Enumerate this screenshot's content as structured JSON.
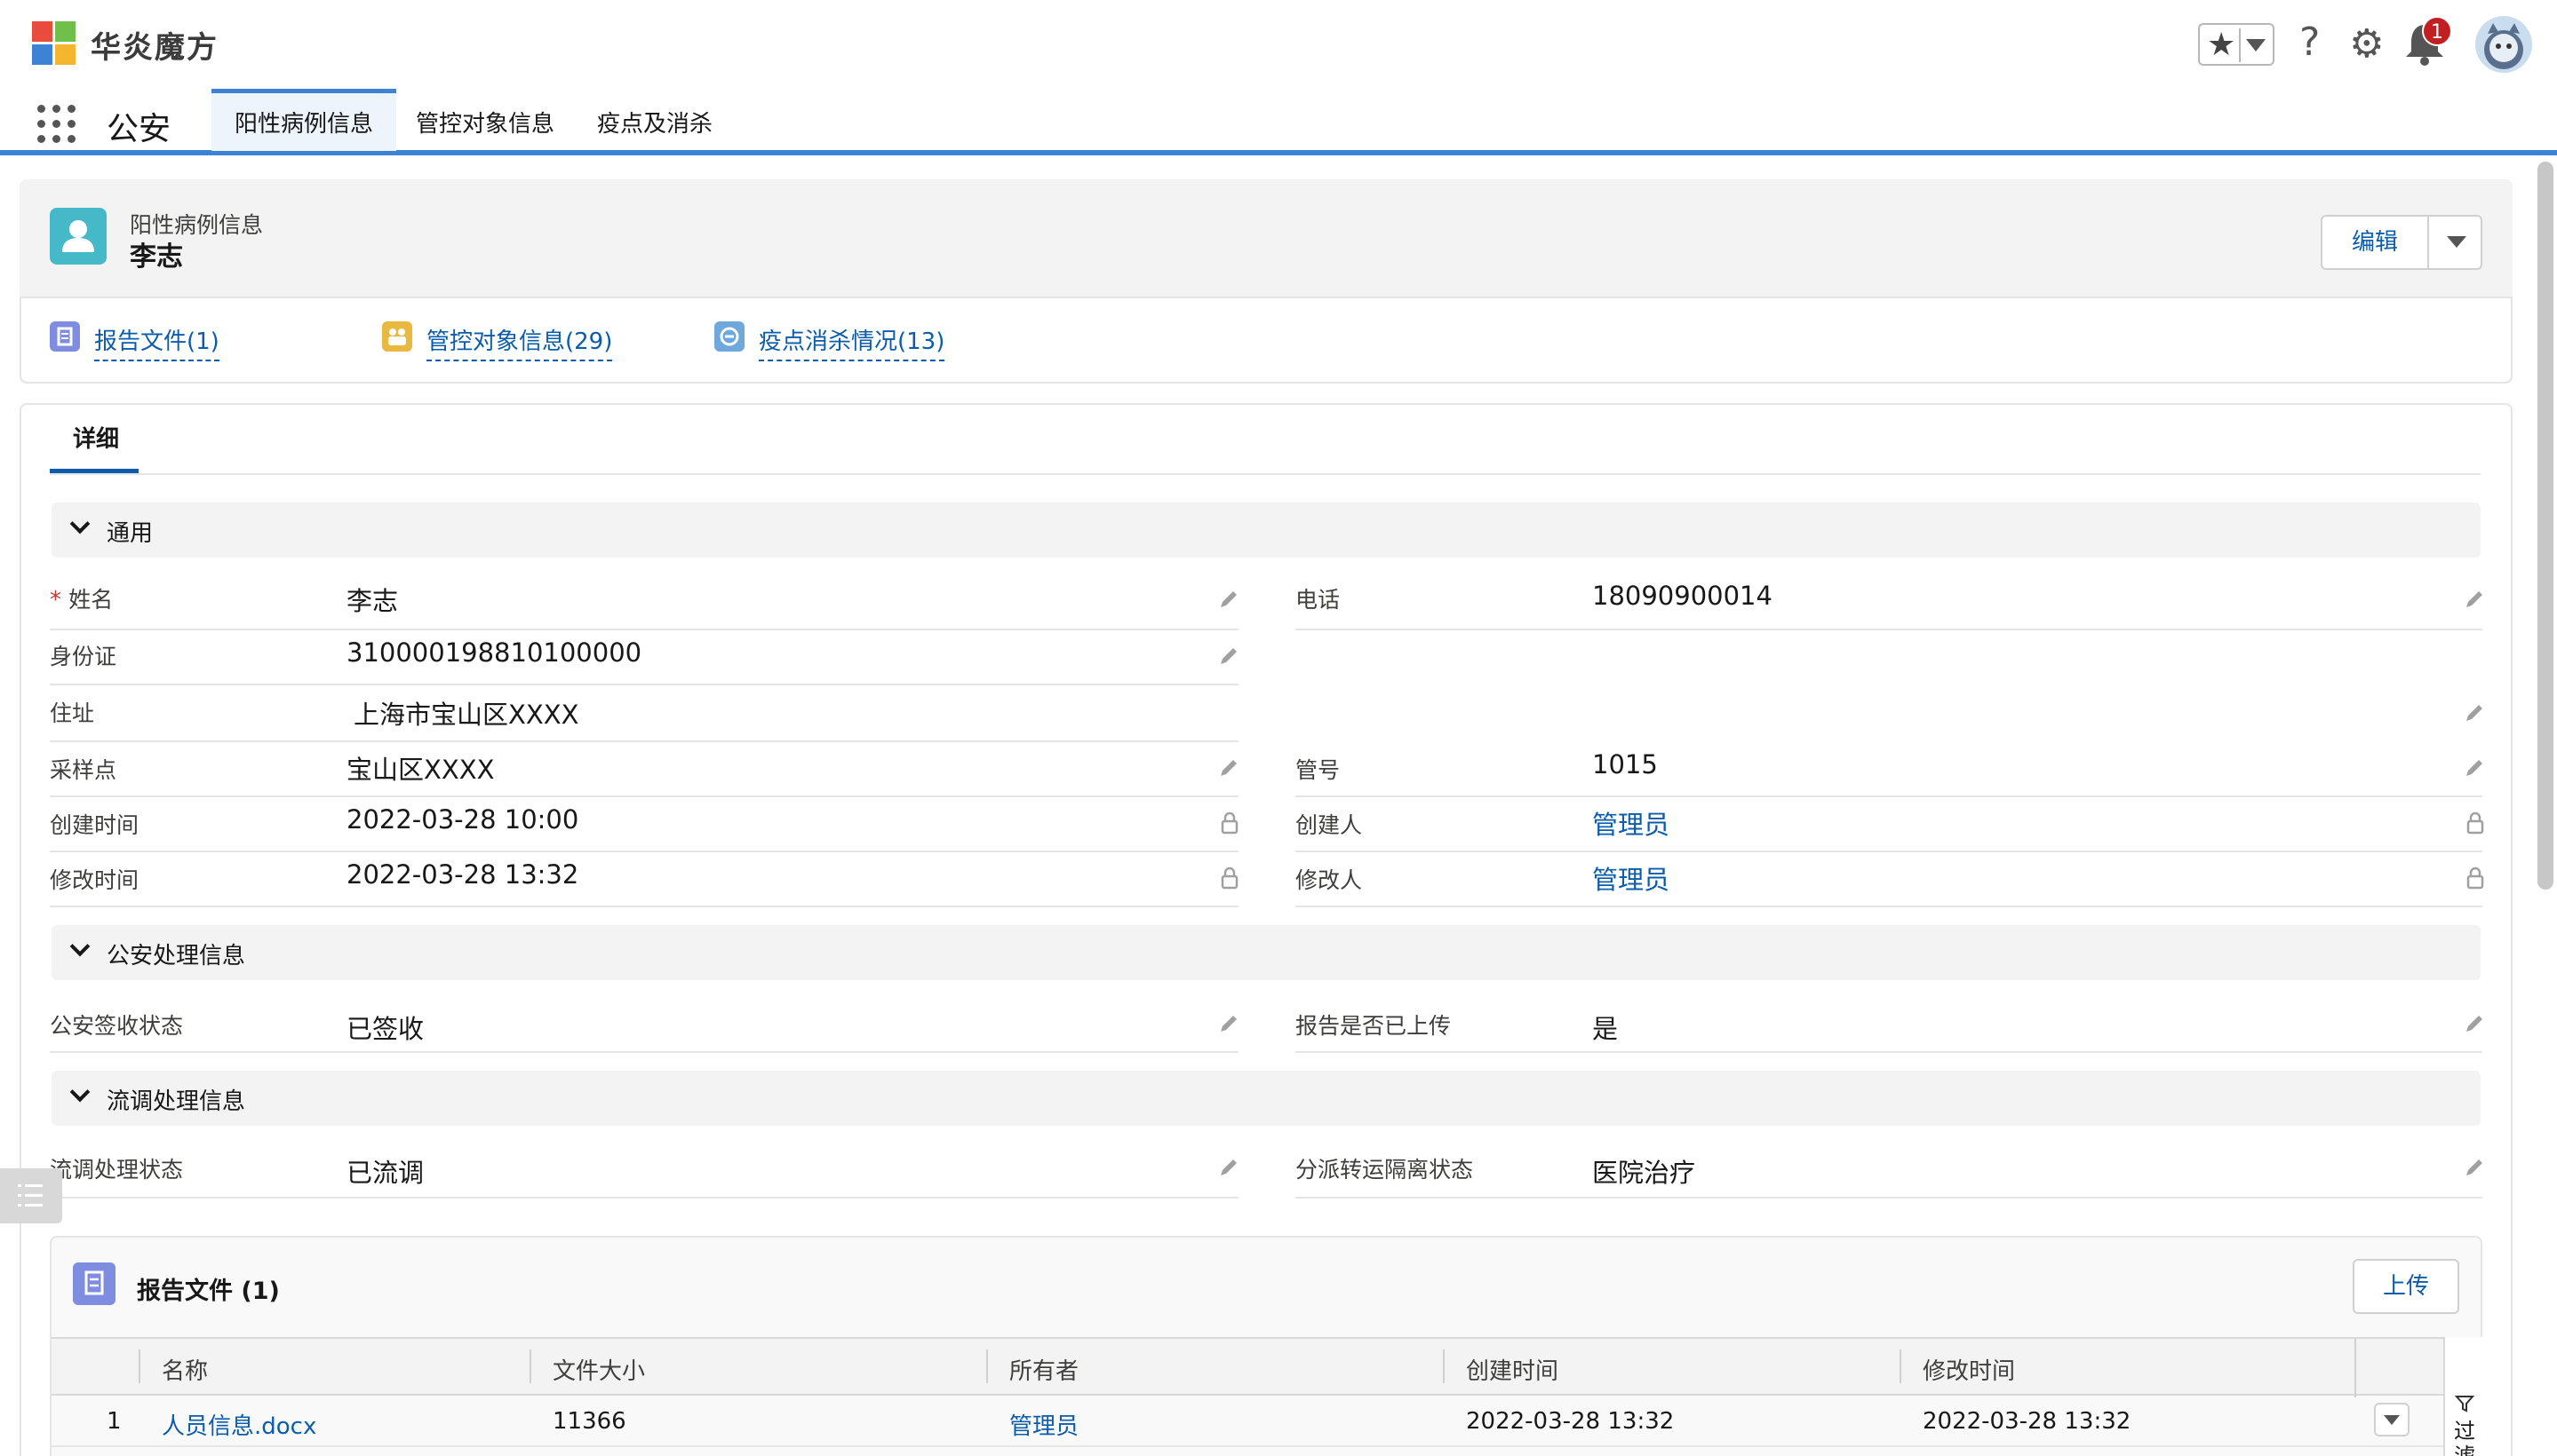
{
  "brand": {
    "name": "华炎魔方"
  },
  "header": {
    "notification_count": "1"
  },
  "nav": {
    "app_name": "公安",
    "tabs": [
      {
        "label": "阳性病例信息"
      },
      {
        "label": "管控对象信息"
      },
      {
        "label": "疫点及消杀"
      }
    ]
  },
  "record": {
    "object_label": "阳性病例信息",
    "name": "李志",
    "edit_label": "编辑"
  },
  "related_links": [
    {
      "label": "报告文件(1)",
      "icon": "file-icon",
      "color": "#7f8de1"
    },
    {
      "label": "管控对象信息(29)",
      "icon": "group-icon",
      "color": "#e9b840"
    },
    {
      "label": "疫点消杀情况(13)",
      "icon": "minus-circle-icon",
      "color": "#6fa8dc"
    }
  ],
  "detail": {
    "tab_label": "详细",
    "sections": {
      "general": "通用",
      "police": "公安处理信息",
      "epi": "流调处理信息"
    },
    "fields": {
      "name_label": "姓名",
      "name_value": "李志",
      "phone_label": "电话",
      "phone_value": "18090900014",
      "id_label": "身份证",
      "id_value": "310000198810100000",
      "address_label": "住址",
      "address_value": "上海市宝山区XXXX",
      "sample_label": "采样点",
      "sample_value": "宝山区XXXX",
      "tube_label": "管号",
      "tube_value": "1015",
      "created_label": "创建时间",
      "created_value": "2022-03-28 10:00",
      "creator_label": "创建人",
      "creator_value": "管理员",
      "modified_label": "修改时间",
      "modified_value": "2022-03-28 13:32",
      "modifier_label": "修改人",
      "modifier_value": "管理员",
      "police_status_label": "公安签收状态",
      "police_status_value": "已签收",
      "report_uploaded_label": "报告是否已上传",
      "report_uploaded_value": "是",
      "epi_status_label": "流调处理状态",
      "epi_status_value": "已流调",
      "dispatch_label": "分派转运隔离状态",
      "dispatch_value": "医院治疗"
    }
  },
  "related_list": {
    "title": "报告文件 (1)",
    "upload_label": "上传",
    "columns": [
      "名称",
      "文件大小",
      "所有者",
      "创建时间",
      "修改时间"
    ],
    "filter_label": "过滤",
    "rows": [
      {
        "index": "1",
        "name": "人员信息.docx",
        "size": "11366",
        "owner": "管理员",
        "created": "2022-03-28 13:32",
        "modified": "2022-03-28 13:32"
      }
    ]
  },
  "colors": {
    "accent": "#3c83d6",
    "link": "#0b5cab",
    "record_icon": "#46b9c9",
    "badge": "#c21f22"
  }
}
